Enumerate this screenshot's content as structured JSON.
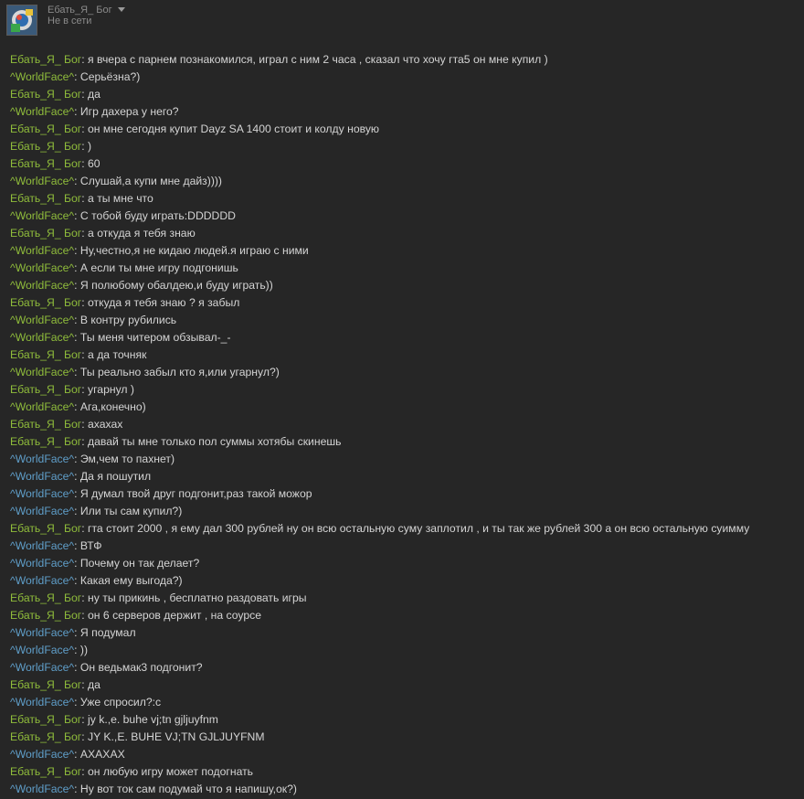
{
  "header": {
    "user_name": "Ебать_Я_ Бог",
    "status": "Не в сети",
    "avatar_icon": "avatar-image",
    "dropdown_icon": "chevron-down-icon"
  },
  "colors": {
    "background": "#262626",
    "self_name": "#8fbc3b",
    "friend_name": "#5f9ec9",
    "message_text": "#d4d4d4",
    "muted_text": "#8a8a8a"
  },
  "messages": [
    {
      "sender": "Ебать_Я_ Бог",
      "role": "green",
      "text": "я вчера с парнем познакомился, играл с ним 2 часа , сказал что хочу гта5 он мне купил )"
    },
    {
      "sender": "^WorldFace^",
      "role": "green",
      "text": "Серьёзна?)"
    },
    {
      "sender": "Ебать_Я_ Бог",
      "role": "green",
      "text": "да"
    },
    {
      "sender": "^WorldFace^",
      "role": "green",
      "text": "Игр дахера у него?"
    },
    {
      "sender": "Ебать_Я_ Бог",
      "role": "green",
      "text": "он мне сегодня купит Dayz SA  1400 стоит и колду новую"
    },
    {
      "sender": "Ебать_Я_ Бог",
      "role": "green",
      "text": ")"
    },
    {
      "sender": "Ебать_Я_ Бог",
      "role": "green",
      "text": "60"
    },
    {
      "sender": "^WorldFace^",
      "role": "green",
      "text": "Слушай,а купи мне дайз))))"
    },
    {
      "sender": "Ебать_Я_ Бог",
      "role": "green",
      "text": "а ты мне что"
    },
    {
      "sender": "^WorldFace^",
      "role": "green",
      "text": "С тобой буду играть:DDDDDD"
    },
    {
      "sender": "Ебать_Я_ Бог",
      "role": "green",
      "text": "а откуда я тебя знаю"
    },
    {
      "sender": "^WorldFace^",
      "role": "green",
      "text": "Ну,честно,я не кидаю людей.я играю с ними"
    },
    {
      "sender": "^WorldFace^",
      "role": "green",
      "text": "А если ты мне игру подгонишь"
    },
    {
      "sender": "^WorldFace^",
      "role": "green",
      "text": "Я полюбому обалдею,и буду играть))"
    },
    {
      "sender": "Ебать_Я_ Бог",
      "role": "green",
      "text": "откуда я тебя знаю ? я забыл"
    },
    {
      "sender": "^WorldFace^",
      "role": "green",
      "text": "В контру рубились"
    },
    {
      "sender": "^WorldFace^",
      "role": "green",
      "text": "Ты меня читером обзывал-_-"
    },
    {
      "sender": "Ебать_Я_ Бог",
      "role": "green",
      "text": "а да точняк"
    },
    {
      "sender": "^WorldFace^",
      "role": "green",
      "text": "Ты реально забыл кто я,или угарнул?)"
    },
    {
      "sender": "Ебать_Я_ Бог",
      "role": "green",
      "text": "угарнул )"
    },
    {
      "sender": "^WorldFace^",
      "role": "green",
      "text": "Ага,конечно)"
    },
    {
      "sender": "Ебать_Я_ Бог",
      "role": "green",
      "text": "ахахах"
    },
    {
      "sender": "Ебать_Я_ Бог",
      "role": "green",
      "text": "давай ты мне только пол суммы хотябы скинешь"
    },
    {
      "sender": "^WorldFace^",
      "role": "blue",
      "text": "Эм,чем то пахнет)"
    },
    {
      "sender": "^WorldFace^",
      "role": "blue",
      "text": "Да я пошутил"
    },
    {
      "sender": "^WorldFace^",
      "role": "blue",
      "text": "Я думал твой друг подгонит,раз такой можор"
    },
    {
      "sender": "^WorldFace^",
      "role": "blue",
      "text": "Или ты сам купил?)"
    },
    {
      "sender": "Ебать_Я_ Бог",
      "role": "green",
      "text": "гта стоит 2000 , я ему дал 300 рублей ну он всю остальную суму заплотил , и ты так же рублей 300 а он всю остальную суимму"
    },
    {
      "sender": "^WorldFace^",
      "role": "blue",
      "text": "ВТФ"
    },
    {
      "sender": "^WorldFace^",
      "role": "blue",
      "text": "Почему он так делает?"
    },
    {
      "sender": "^WorldFace^",
      "role": "blue",
      "text": "Какая ему выгода?)"
    },
    {
      "sender": "Ебать_Я_ Бог",
      "role": "green",
      "text": "ну ты прикинь , бесплатно раздовать игры"
    },
    {
      "sender": "Ебать_Я_ Бог",
      "role": "green",
      "text": "он 6 серверов держит , на соурсе"
    },
    {
      "sender": "^WorldFace^",
      "role": "blue",
      "text": "Я подумал"
    },
    {
      "sender": "^WorldFace^",
      "role": "blue",
      "text": "))"
    },
    {
      "sender": "^WorldFace^",
      "role": "blue",
      "text": "Он ведьмак3 подгонит?"
    },
    {
      "sender": "Ебать_Я_ Бог",
      "role": "green",
      "text": "да"
    },
    {
      "sender": "^WorldFace^",
      "role": "blue",
      "text": "Уже спросил?:с"
    },
    {
      "sender": "Ебать_Я_ Бог",
      "role": "green",
      "text": "jy k.,e. buhe vj;tn gjljuyfnm"
    },
    {
      "sender": "Ебать_Я_ Бог",
      "role": "green",
      "text": "JY K.,E. BUHE VJ;TN GJLJUYFNM"
    },
    {
      "sender": "^WorldFace^",
      "role": "blue",
      "text": "АХАХАХ"
    },
    {
      "sender": "Ебать_Я_ Бог",
      "role": "green",
      "text": "он любую игру может подогнать"
    },
    {
      "sender": "^WorldFace^",
      "role": "blue",
      "text": "Ну вот ток сам подумай что я напишу,ок?)"
    }
  ]
}
